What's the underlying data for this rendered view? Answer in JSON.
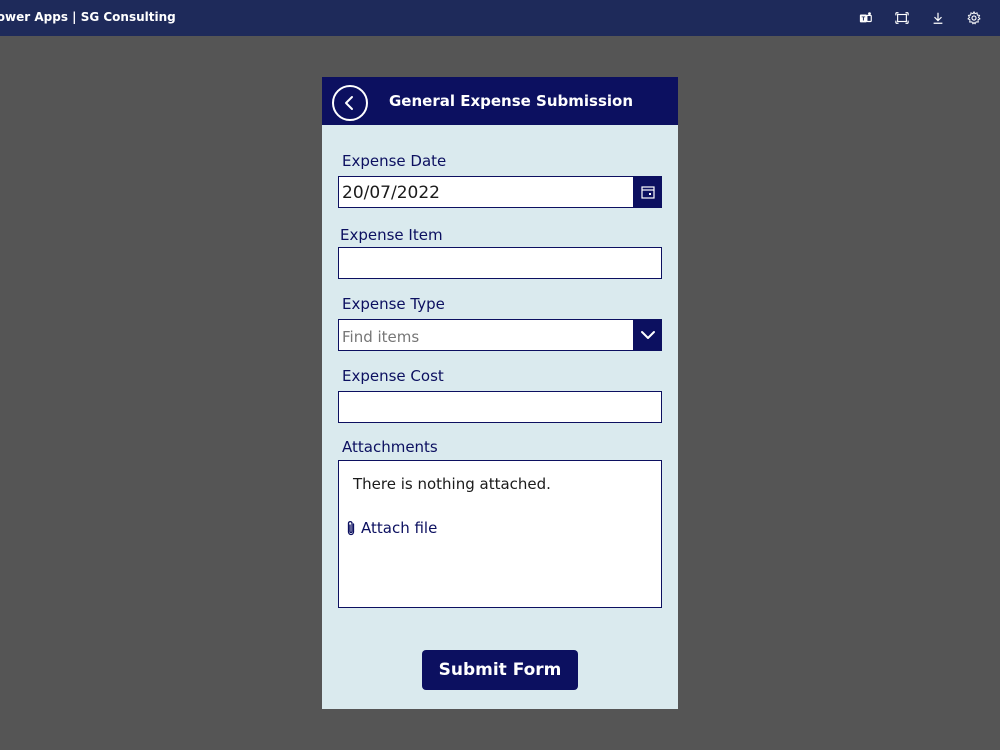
{
  "topbar": {
    "title": "Power Apps  |  SG Consulting",
    "icons": [
      "teams-icon",
      "fit-screen-icon",
      "download-icon",
      "settings-icon"
    ]
  },
  "app": {
    "title": "General Expense Submission",
    "fields": {
      "expense_date": {
        "label": "Expense Date",
        "value": "20/07/2022"
      },
      "expense_item": {
        "label": "Expense Item",
        "value": ""
      },
      "expense_type": {
        "label": "Expense Type",
        "placeholder": "Find items"
      },
      "expense_cost": {
        "label": "Expense Cost",
        "value": ""
      }
    },
    "attachments": {
      "label": "Attachments",
      "empty_text": "There is nothing attached.",
      "attach_label": "Attach file"
    },
    "submit_label": "Submit Form"
  },
  "colors": {
    "topbar_bg": "#1e2a5a",
    "header_bg": "#0c1060",
    "form_bg": "#daeaee",
    "page_bg": "#555555"
  }
}
